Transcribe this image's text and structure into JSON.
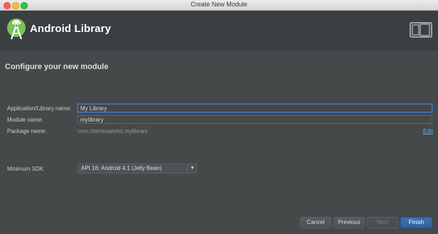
{
  "window": {
    "title": "Create New Module"
  },
  "header": {
    "title": "Android Library",
    "logo_icon": "android-studio-logo",
    "device_icon": "phone-tablet-icon"
  },
  "main": {
    "section_title": "Configure your new module",
    "fields": {
      "app_name_label": "Application/Library name:",
      "app_name_value": "My Library",
      "module_name_label": "Module name:",
      "module_name_value": "mylibrary",
      "package_name_label": "Package name:",
      "package_name_value": "com.chensuworks.mylibrary",
      "edit_link": "Edit",
      "min_sdk_label": "Minimum SDK",
      "min_sdk_value": "API 16: Android 4.1 (Jelly Bean)"
    }
  },
  "buttons": {
    "cancel": "Cancel",
    "previous": "Previous",
    "next": "Next",
    "finish": "Finish"
  },
  "colors": {
    "background": "#45494a",
    "header": "#3c3f41",
    "accent": "#3f72b8",
    "link": "#6ea4e8"
  }
}
